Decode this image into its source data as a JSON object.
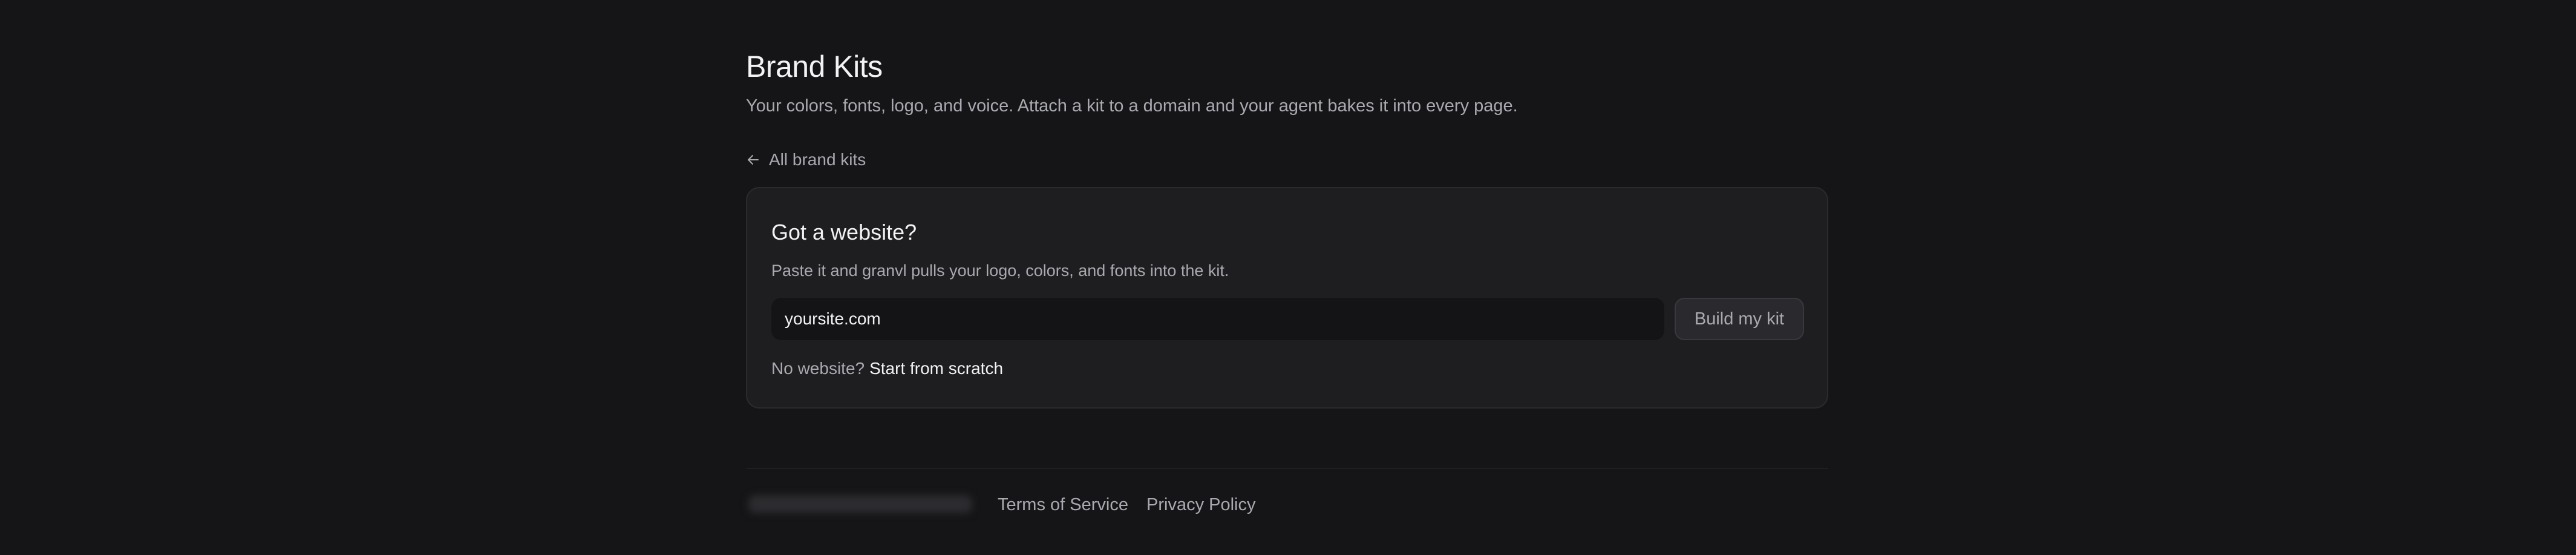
{
  "header": {
    "title": "Brand Kits",
    "subtitle": "Your colors, fonts, logo, and voice. Attach a kit to a domain and your agent bakes it into every page."
  },
  "back_link": {
    "icon": "arrow-left-icon",
    "label": "All brand kits"
  },
  "card": {
    "title": "Got a website?",
    "description": "Paste it and granvl pulls your logo, colors, and fonts into the kit.",
    "url_input": {
      "value": "",
      "placeholder": "yoursite.com"
    },
    "build_button_label": "Build my kit",
    "scratch_prompt": "No website?",
    "scratch_link_label": "Start from scratch"
  },
  "footer": {
    "terms_label": "Terms of Service",
    "privacy_label": "Privacy Policy"
  },
  "colors": {
    "background": "#151517",
    "card": "#1e1e21",
    "text_primary": "#f3f3f5",
    "text_muted": "#a9a9b0"
  }
}
